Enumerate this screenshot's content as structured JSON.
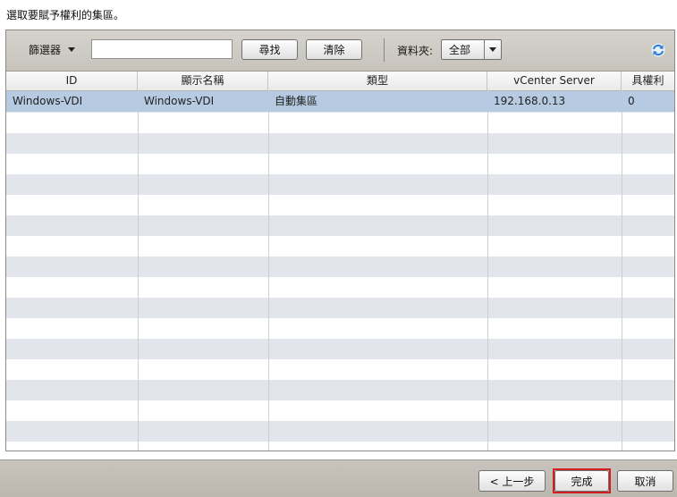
{
  "instruction": "選取要賦予權利的集區。",
  "toolbar": {
    "filter_label": "篩選器",
    "search_value": "",
    "find_label": "尋找",
    "clear_label": "清除",
    "folder_label": "資料夾:",
    "folder_value": "全部"
  },
  "icons": {
    "filter_caret": "chevron-down-icon",
    "folder_caret": "chevron-down-icon",
    "refresh": "refresh-icon"
  },
  "colors": {
    "selected_row": "#b6cbe1",
    "highlight_outline": "#d21e1e",
    "refresh_icon": "#2a7fd4"
  },
  "table": {
    "columns": [
      "ID",
      "顯示名稱",
      "類型",
      "vCenter Server",
      "具權利"
    ],
    "rows": [
      {
        "id": "Windows-VDI",
        "display_name": "Windows-VDI",
        "type": "自動集區",
        "vcenter": "192.168.0.13",
        "entitled": "0",
        "selected": true
      }
    ]
  },
  "footer": {
    "back_label": "< 上一步",
    "finish_label": "完成",
    "cancel_label": "取消"
  }
}
